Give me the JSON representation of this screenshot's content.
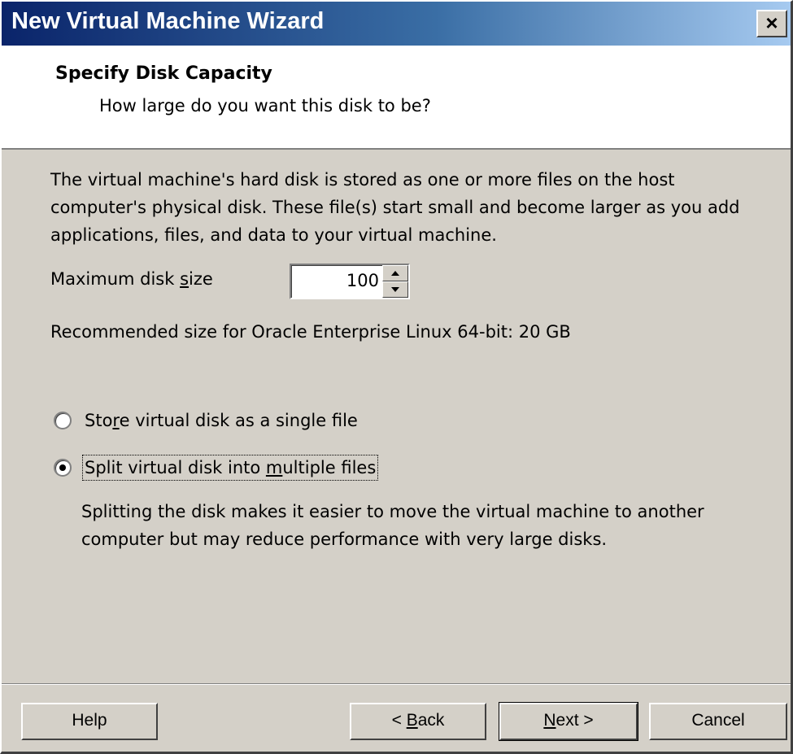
{
  "window": {
    "title": "New Virtual Machine Wizard",
    "close_label": "×"
  },
  "header": {
    "title": "Specify Disk Capacity",
    "subtitle": "How large do you want this disk to be?"
  },
  "body": {
    "description": "The virtual machine's hard disk is stored as one or more files on the host computer's physical disk. These file(s) start small and become larger as you add applications, files, and data to your virtual machine.",
    "disk_size_label_pre": "Maximum disk ",
    "disk_size_label_accel": "s",
    "disk_size_label_post": "ize",
    "disk_size_value": "100",
    "recommended": "Recommended size for Oracle Enterprise Linux 64-bit: 20 GB",
    "option_single_pre": "Sto",
    "option_single_accel": "r",
    "option_single_post": "e virtual disk as a single file",
    "option_single_selected": false,
    "option_split_pre": "Split virtual disk into ",
    "option_split_accel": "m",
    "option_split_post": "ultiple files",
    "option_split_selected": true,
    "split_description": "Splitting the disk makes it easier to move the virtual machine to another computer but may reduce performance with very large disks."
  },
  "buttons": {
    "help": "Help",
    "back_pre": "< ",
    "back_accel": "B",
    "back_post": "ack",
    "next_accel": "N",
    "next_post": "ext >",
    "cancel": "Cancel"
  },
  "icons": {
    "close": "close-icon",
    "spin_up": "arrow-up-icon",
    "spin_down": "arrow-down-icon",
    "radio_selected": "radio-selected-icon",
    "radio_unselected": "radio-unselected-icon"
  }
}
